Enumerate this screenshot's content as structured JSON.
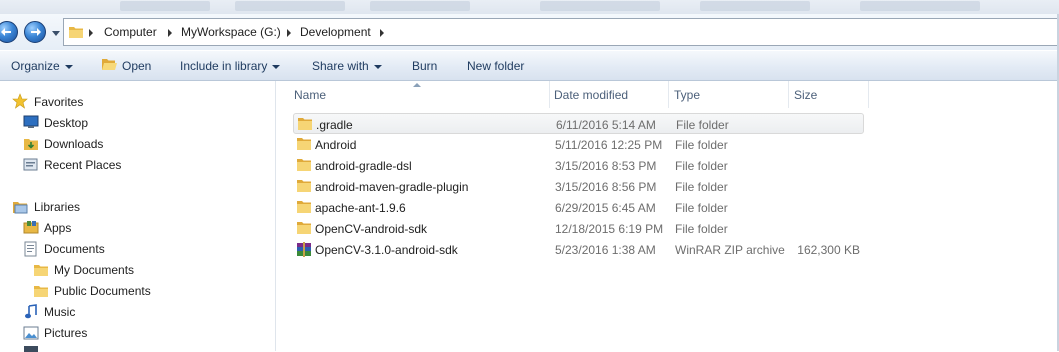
{
  "address": {
    "crumbs": [
      "Computer",
      "MyWorkspace (G:)",
      "Development"
    ]
  },
  "toolbar": {
    "organize": "Organize",
    "open": "Open",
    "include_in_library": "Include in library",
    "share_with": "Share with",
    "burn": "Burn",
    "new_folder": "New folder"
  },
  "sidebar": {
    "favorites": {
      "label": "Favorites",
      "items": [
        "Desktop",
        "Downloads",
        "Recent Places"
      ]
    },
    "libraries": {
      "label": "Libraries",
      "items": [
        "Apps",
        "Documents",
        "My Documents",
        "Public Documents",
        "Music",
        "Pictures"
      ]
    }
  },
  "columns": [
    "Name",
    "Date modified",
    "Type",
    "Size"
  ],
  "files": [
    {
      "name": ".gradle",
      "date": "6/11/2016 5:14 AM",
      "type": "File folder",
      "size": "",
      "icon": "folder-icon",
      "selected": true
    },
    {
      "name": "Android",
      "date": "5/11/2016 12:25 PM",
      "type": "File folder",
      "size": "",
      "icon": "folder-icon"
    },
    {
      "name": "android-gradle-dsl",
      "date": "3/15/2016 8:53 PM",
      "type": "File folder",
      "size": "",
      "icon": "folder-icon"
    },
    {
      "name": "android-maven-gradle-plugin",
      "date": "3/15/2016 8:56 PM",
      "type": "File folder",
      "size": "",
      "icon": "folder-icon"
    },
    {
      "name": "apache-ant-1.9.6",
      "date": "6/29/2015 6:45 AM",
      "type": "File folder",
      "size": "",
      "icon": "folder-icon"
    },
    {
      "name": "OpenCV-android-sdk",
      "date": "12/18/2015 6:19 PM",
      "type": "File folder",
      "size": "",
      "icon": "folder-icon"
    },
    {
      "name": "OpenCV-3.1.0-android-sdk",
      "date": "5/23/2016 1:38 AM",
      "type": "WinRAR ZIP archive",
      "size": "162,300 KB",
      "icon": "winrar-archive-icon"
    }
  ]
}
